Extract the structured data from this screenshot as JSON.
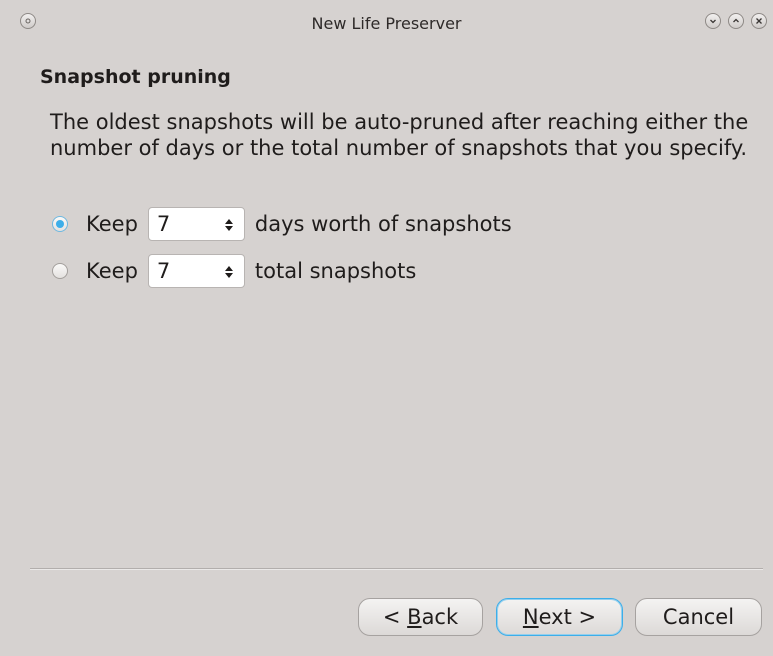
{
  "window": {
    "title": "New Life Preserver"
  },
  "page": {
    "heading": "Snapshot pruning",
    "description": "The oldest snapshots will be auto-pruned after reaching either the number of days or the total number of snapshots that you specify."
  },
  "options": [
    {
      "prefix": "Keep",
      "value": "7",
      "suffix": "days worth of snapshots",
      "checked": true
    },
    {
      "prefix": "Keep",
      "value": "7",
      "suffix": "total snapshots",
      "checked": false
    }
  ],
  "buttons": {
    "back_prefix": "< ",
    "back_mnemonic": "B",
    "back_rest": "ack",
    "next_mnemonic": "N",
    "next_rest": "ext >",
    "cancel": "Cancel"
  },
  "colors": {
    "accent": "#3daee9",
    "background": "#d6d2d0"
  }
}
